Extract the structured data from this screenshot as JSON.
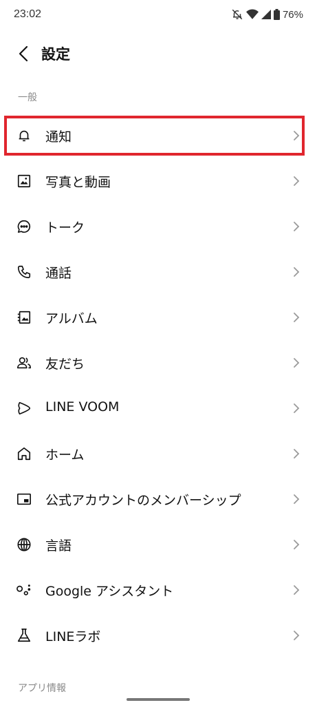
{
  "status_bar": {
    "time": "23:02",
    "battery": "76%",
    "icons": [
      "notifications-off-icon",
      "wifi-icon",
      "cellular-signal-icon",
      "battery-icon"
    ]
  },
  "header": {
    "title": "設定",
    "back_icon": "back-arrow-icon"
  },
  "sections": {
    "general_label": "一般",
    "app_info_label": "アプリ情報"
  },
  "settings": {
    "items": [
      {
        "label": "通知",
        "icon": "bell-icon",
        "highlighted": true
      },
      {
        "label": "写真と動画",
        "icon": "image-icon"
      },
      {
        "label": "トーク",
        "icon": "chat-bubble-icon"
      },
      {
        "label": "通話",
        "icon": "phone-icon"
      },
      {
        "label": "アルバム",
        "icon": "album-icon"
      },
      {
        "label": "友だち",
        "icon": "friends-icon"
      },
      {
        "label": "LINE VOOM",
        "icon": "voom-play-icon"
      },
      {
        "label": "ホーム",
        "icon": "home-icon"
      },
      {
        "label": "公式アカウントのメンバーシップ",
        "icon": "membership-card-icon"
      },
      {
        "label": "言語",
        "icon": "globe-icon"
      },
      {
        "label": "Google アシスタント",
        "icon": "google-assistant-icon"
      },
      {
        "label": "LINEラボ",
        "icon": "flask-icon"
      }
    ]
  },
  "colors": {
    "highlight_border": "#e0262e",
    "section_label": "#8a8a8a",
    "chevron": "#9a9a9a"
  }
}
